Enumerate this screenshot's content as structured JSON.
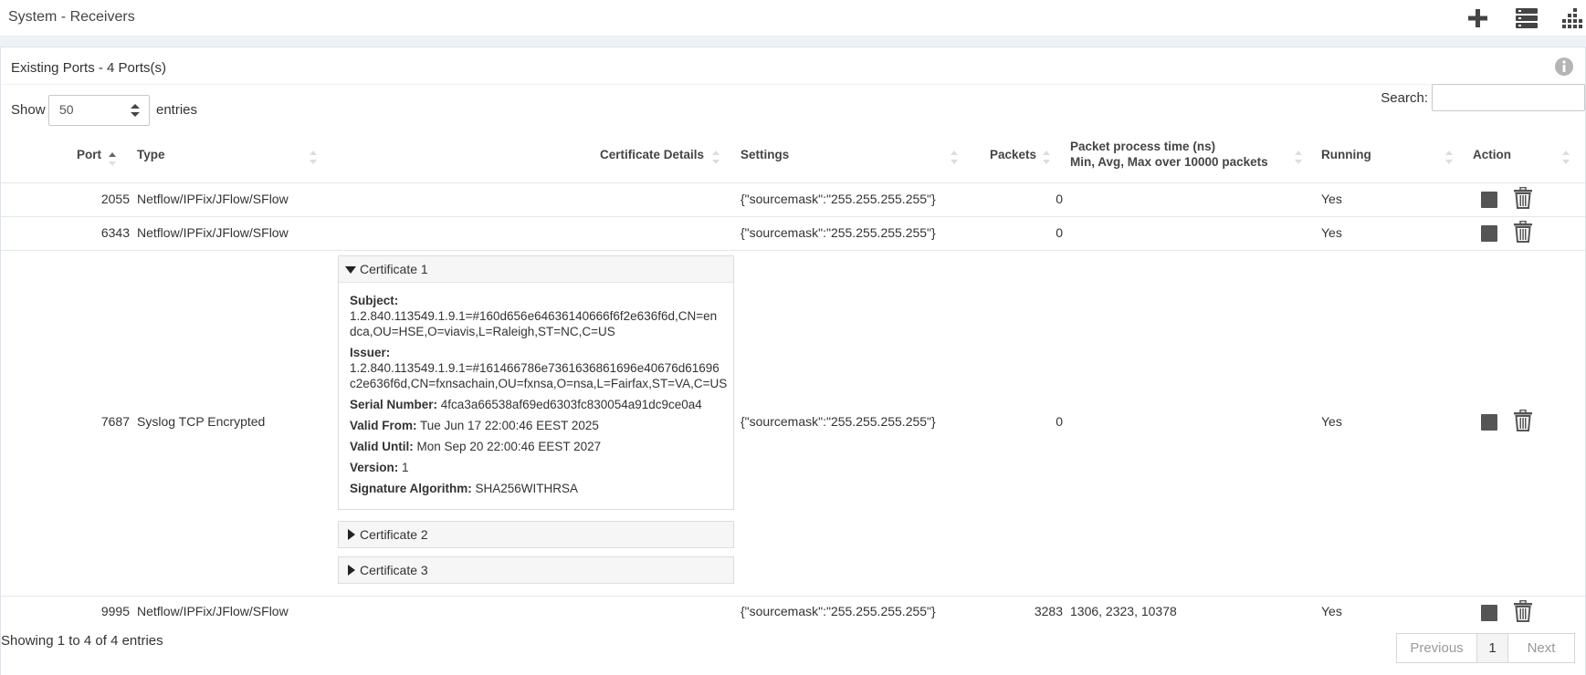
{
  "header": {
    "title": "System - Receivers",
    "icons": [
      "plus-icon",
      "server-list-icon",
      "bars-chart-icon"
    ]
  },
  "panel": {
    "title": "Existing Ports - 4 Ports(s)",
    "info_icon": "info-icon"
  },
  "length_menu": {
    "prefix": "Show",
    "value": "50",
    "suffix": "entries"
  },
  "search": {
    "label": "Search:",
    "value": "",
    "placeholder": ""
  },
  "table": {
    "columns": {
      "port": "Port",
      "type": "Type",
      "certificate": "Certificate Details",
      "settings": "Settings",
      "packets": "Packets",
      "ppt_line1": "Packet process time (ns)",
      "ppt_line2": "Min, Avg, Max over 10000 packets",
      "running": "Running",
      "action": "Action"
    },
    "rows": [
      {
        "port": "2055",
        "type": "Netflow/IPFix/JFlow/SFlow",
        "settings": "{\"sourcemask\":\"255.255.255.255\"}",
        "packets": "0",
        "ppt": "",
        "running": "Yes"
      },
      {
        "port": "6343",
        "type": "Netflow/IPFix/JFlow/SFlow",
        "settings": "{\"sourcemask\":\"255.255.255.255\"}",
        "packets": "0",
        "ppt": "",
        "running": "Yes"
      },
      {
        "port": "7687",
        "type": "Syslog TCP Encrypted",
        "settings": "{\"sourcemask\":\"255.255.255.255\"}",
        "packets": "0",
        "ppt": "",
        "running": "Yes"
      },
      {
        "port": "9995",
        "type": "Netflow/IPFix/JFlow/SFlow",
        "settings": "{\"sourcemask\":\"255.255.255.255\"}",
        "packets": "3283",
        "ppt": "1306, 2323, 10378",
        "running": "Yes"
      }
    ],
    "certificates": [
      {
        "title": "Certificate 1",
        "expanded": true,
        "subject_label": "Subject:",
        "subject_line1": "1.2.840.113549.1.9.1=#160d656e64636140666f6f2e636f6d,CN=en",
        "subject_line2": "dca,OU=HSE,O=viavis,L=Raleigh,ST=NC,C=US",
        "issuer_label": "Issuer:",
        "issuer_line1": "1.2.840.113549.1.9.1=#161466786e7361636861696e40676d61696",
        "issuer_line2": "c2e636f6d,CN=fxnsachain,OU=fxnsa,O=nsa,L=Fairfax,ST=VA,C=US",
        "serial_label": "Serial Number:",
        "serial": "4fca3a66538af69ed6303fc830054a91dc9ce0a4",
        "valid_from_label": "Valid From:",
        "valid_from": "Tue Jun 17 22:00:46 EEST 2025",
        "valid_until_label": "Valid Until:",
        "valid_until": "Mon Sep 20 22:00:46 EEST 2027",
        "version_label": "Version:",
        "version": "1",
        "sigalg_label": "Signature Algorithm:",
        "sigalg": "SHA256WITHRSA"
      },
      {
        "title": "Certificate 2",
        "expanded": false
      },
      {
        "title": "Certificate 3",
        "expanded": false
      }
    ]
  },
  "footer": {
    "info": "Showing 1 to 4 of 4 entries",
    "previous": "Previous",
    "page": "1",
    "next": "Next"
  },
  "colors": {
    "stop_button": "#555555",
    "border": "#dde3e8",
    "strip": "#eef2f6"
  }
}
